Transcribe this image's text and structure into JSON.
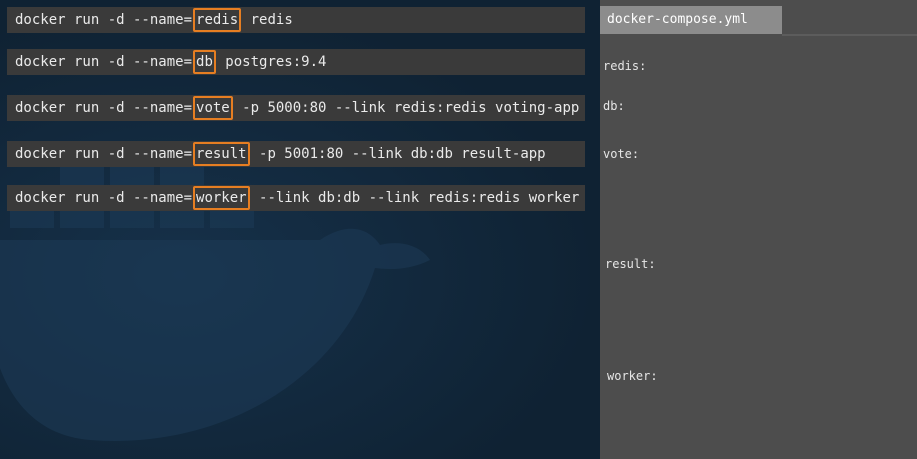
{
  "commands": [
    {
      "prefix": "docker run -d --name=",
      "name": "redis",
      "suffix": " redis"
    },
    {
      "prefix": "docker run -d --name=",
      "name": "db",
      "suffix": " postgres:9.4"
    },
    {
      "prefix": "docker run -d --name=",
      "name": "vote",
      "suffix": " -p 5000:80 --link redis:redis voting-app"
    },
    {
      "prefix": "docker run -d --name=",
      "name": "result",
      "suffix": " -p 5001:80 --link db:db result-app"
    },
    {
      "prefix": "docker run -d --name=",
      "name": "worker",
      "suffix": " --link db:db --link redis:redis worker"
    }
  ],
  "compose": {
    "tab_label": "docker-compose.yml",
    "keys": [
      "redis:",
      "db:",
      "vote:",
      "result:",
      "worker:"
    ]
  },
  "colors": {
    "highlight": "#e67e22",
    "command_bg": "#3a3a3a",
    "panel_bg": "#4d4d4d",
    "tab_bg": "#8c8c8c",
    "background": "#0f2233"
  }
}
